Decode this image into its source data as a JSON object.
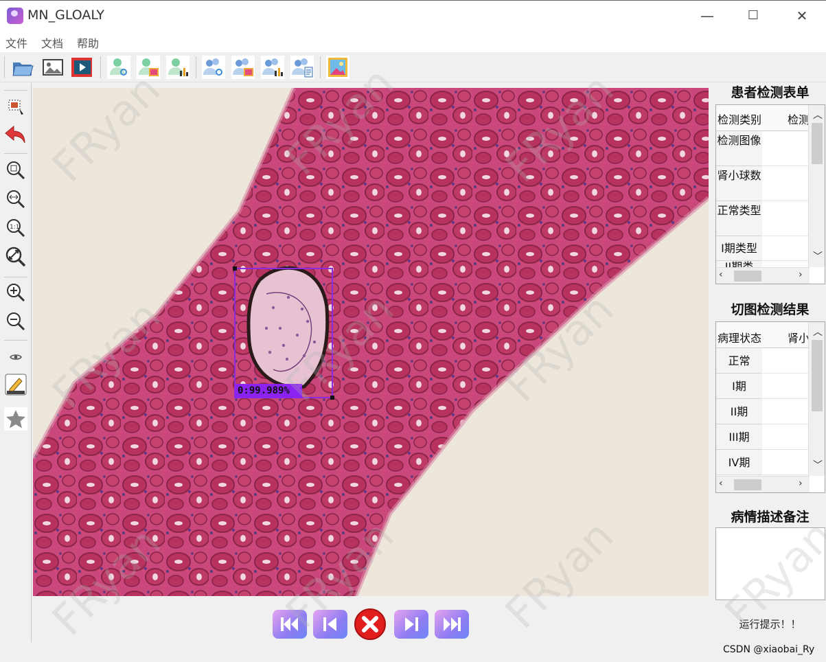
{
  "app": {
    "title": "MN_GLOALY"
  },
  "window_controls": {
    "minimize": "—",
    "maximize": "☐",
    "close": "✕"
  },
  "menu": [
    "文件",
    "文档",
    "帮助"
  ],
  "toolbar": {
    "icons": [
      "open-folder-icon",
      "image-icon",
      "video-icon",
      "patient-diagnose-icon",
      "patient-image-icon",
      "patient-chart-icon",
      "group-diagnose-icon",
      "group-image-icon",
      "group-chart-icon",
      "group-report-icon",
      "gallery-icon"
    ]
  },
  "left_tools": [
    "select-region-icon",
    "undo-icon",
    "zoom-fit-icon",
    "zoom-width-icon",
    "zoom-actual-icon",
    "zoom-auto-icon",
    "zoom-in-icon",
    "zoom-out-icon",
    "eye-icon",
    "label-edit-icon",
    "star-icon"
  ],
  "detection": {
    "label": "0:99.989%"
  },
  "patient_form": {
    "title": "患者检测表单",
    "headers": [
      "检测类别",
      "检测"
    ],
    "rows": [
      "检测图像",
      "肾小球数",
      "正常类型",
      "I期类型",
      "II期类"
    ]
  },
  "slice_results": {
    "title": "切图检测结果",
    "headers": [
      "病理状态",
      "肾小"
    ],
    "rows": [
      "正常",
      "I期",
      "II期",
      "III期",
      "IV期"
    ]
  },
  "notes": {
    "title": "病情描述备注",
    "text": ""
  },
  "status": {
    "hint": "运行提示！！"
  },
  "watermark": "FRyan",
  "credit": "CSDN @xiaobai_Ry",
  "colors": {
    "tissue": "#c23a62",
    "box": "#8b2be0",
    "label_bg": "#8b22f0",
    "close_btn": "#e02020"
  }
}
